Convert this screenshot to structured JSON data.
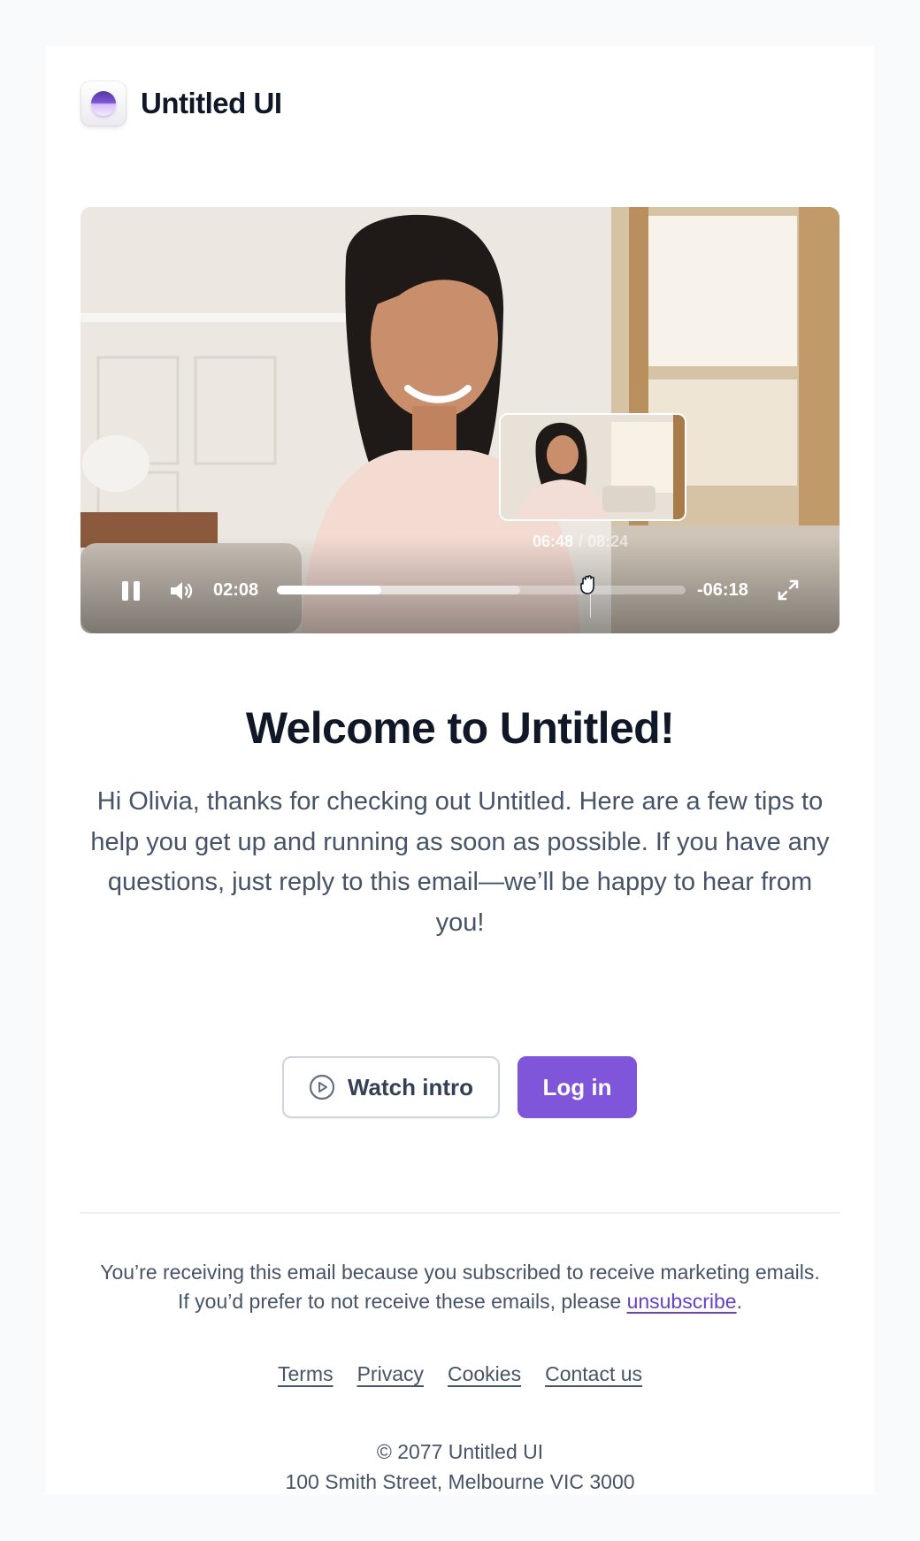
{
  "brand": {
    "name": "Untitled UI"
  },
  "video": {
    "current_time": "02:08",
    "remaining_time": "-06:18",
    "progress": 0.256,
    "buffered": 0.595,
    "preview": {
      "hover_time": "06:48",
      "total_time": "08:24"
    }
  },
  "content": {
    "headline": "Welcome to Untitled!",
    "intro": "Hi Olivia, thanks for checking out Untitled. Here are a few tips to help you get up and running as soon as possible. If you have any questions, just reply to this email—we’ll be happy to hear from you!"
  },
  "actions": {
    "watch_label": "Watch intro",
    "login_label": "Log in"
  },
  "footer": {
    "notice_line1": "You’re receiving this email because you subscribed to receive marketing emails.",
    "notice_line2_prefix": "If you’d prefer to not receive these emails, please ",
    "unsubscribe_label": "unsubscribe",
    "notice_line2_suffix": ".",
    "links": [
      "Terms",
      "Privacy",
      "Cookies",
      "Contact us"
    ],
    "copyright": "© 2077 Untitled UI",
    "address": "100 Smith Street, Melbourne VIC 3000"
  },
  "colors": {
    "accent": "#7f56d9",
    "link": "#6941c6",
    "heading": "#101828",
    "body_text": "#475467"
  },
  "icons": [
    "logo-orb-icon",
    "pause-icon",
    "volume-icon",
    "fullscreen-icon",
    "play-circle-icon",
    "grab-cursor-icon"
  ]
}
